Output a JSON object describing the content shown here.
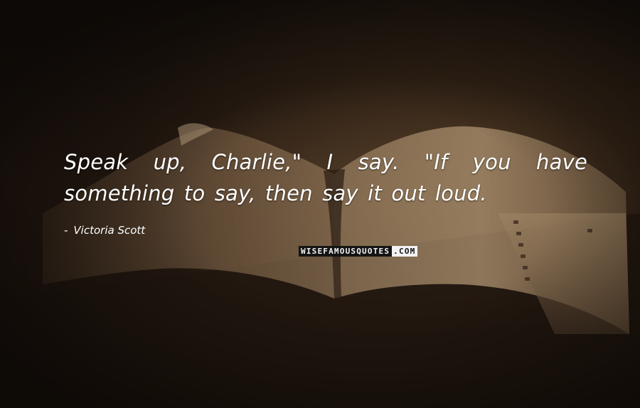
{
  "quote": {
    "text": "Speak up, Charlie,\" I say. \"If you have something to say, then say it out loud."
  },
  "author": {
    "dash": "-",
    "name": "Victoria Scott"
  },
  "watermark": {
    "main": "WISEFAMOUSQUOTES",
    "tld": ".COM"
  },
  "background": {
    "description_colors": {
      "dark": "#1a120c",
      "page_light": "#b59a78",
      "text": "#ffffff"
    }
  }
}
